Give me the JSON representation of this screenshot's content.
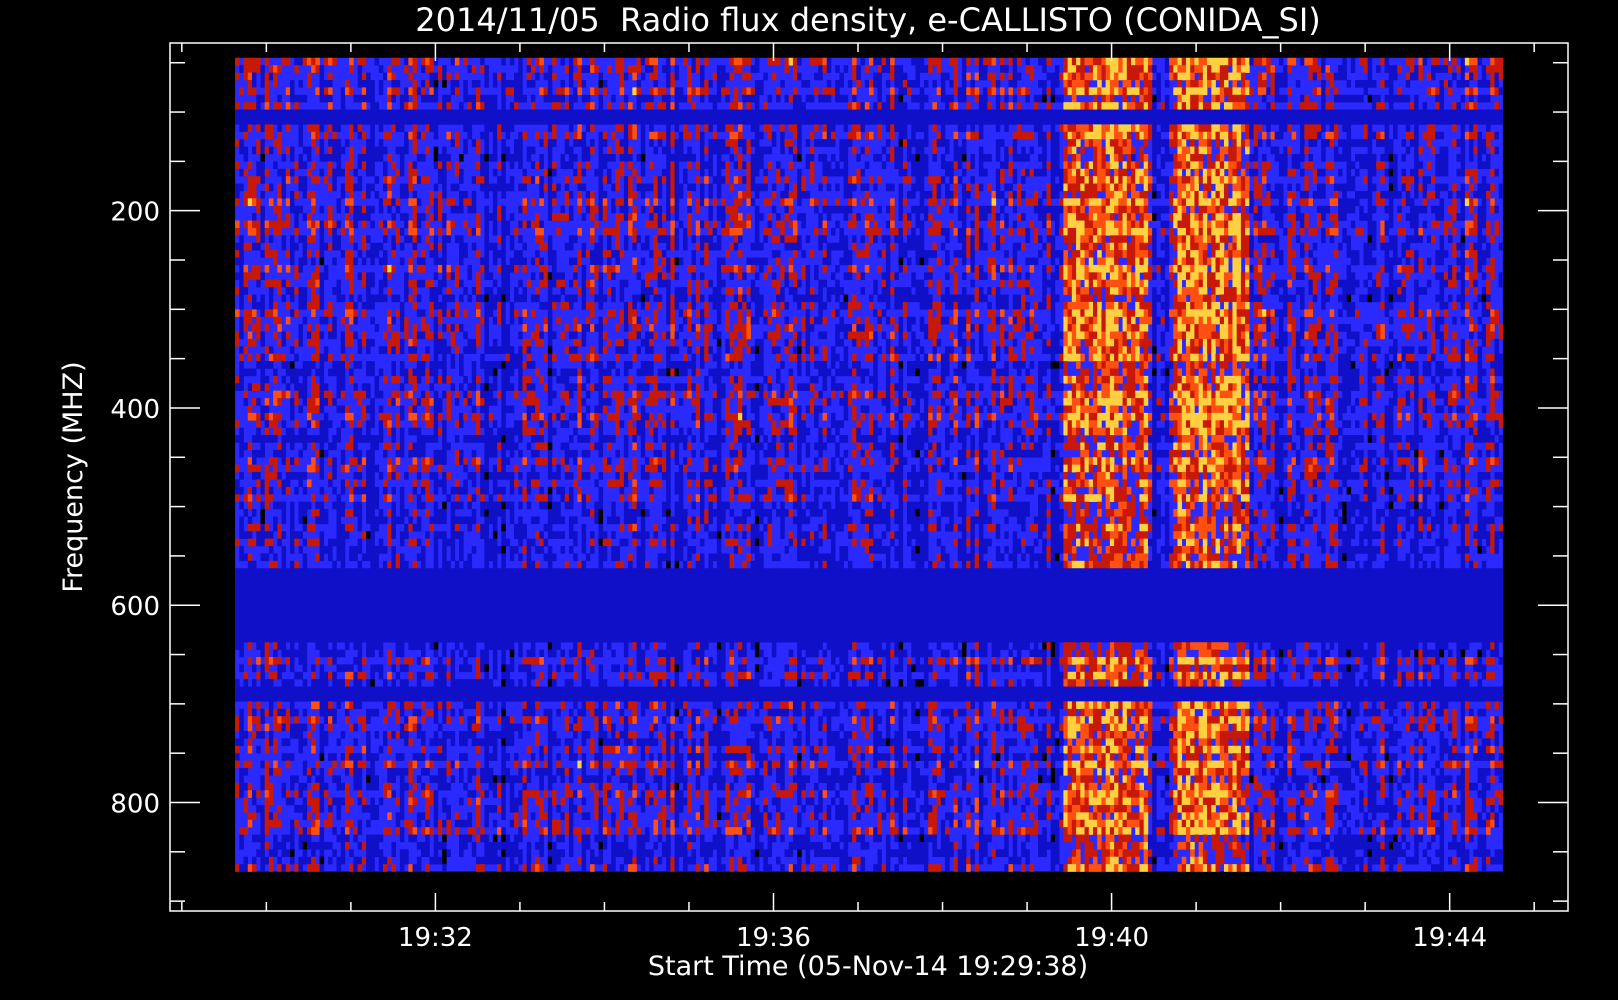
{
  "chart_data": {
    "type": "heatmap",
    "title": "2014/11/05  Radio flux density, e-CALLISTO (CONIDA_SI)",
    "xlabel": "Start Time (05-Nov-14 19:29:38)",
    "ylabel": "Frequency (MHZ)",
    "x_tick_labels": [
      "19:32",
      "19:36",
      "19:40",
      "19:44"
    ],
    "x_tick_minutes": [
      2.37,
      6.37,
      10.37,
      14.37
    ],
    "x_data_range_minutes": [
      0,
      15.0
    ],
    "x_axis_range_minutes": [
      -0.77,
      15.77
    ],
    "y_tick_labels": [
      "200",
      "400",
      "600",
      "800"
    ],
    "y_tick_values": [
      200,
      400,
      600,
      800
    ],
    "y_data_range_mhz": [
      45,
      870
    ],
    "y_axis_range_mhz": [
      30,
      910
    ],
    "y_inverted": true,
    "colormap": [
      "#000000",
      "#1010c8",
      "#2a2aff",
      "#c81808",
      "#ff5010",
      "#ffd040"
    ],
    "bright_time_bands_minutes": [
      [
        9.8,
        10.8
      ],
      [
        11.1,
        12.0
      ]
    ],
    "quiet_frequency_bands_mhz": [
      [
        565,
        640
      ],
      [
        680,
        700
      ],
      [
        100,
        115
      ]
    ],
    "grid": false,
    "legend": "none"
  }
}
